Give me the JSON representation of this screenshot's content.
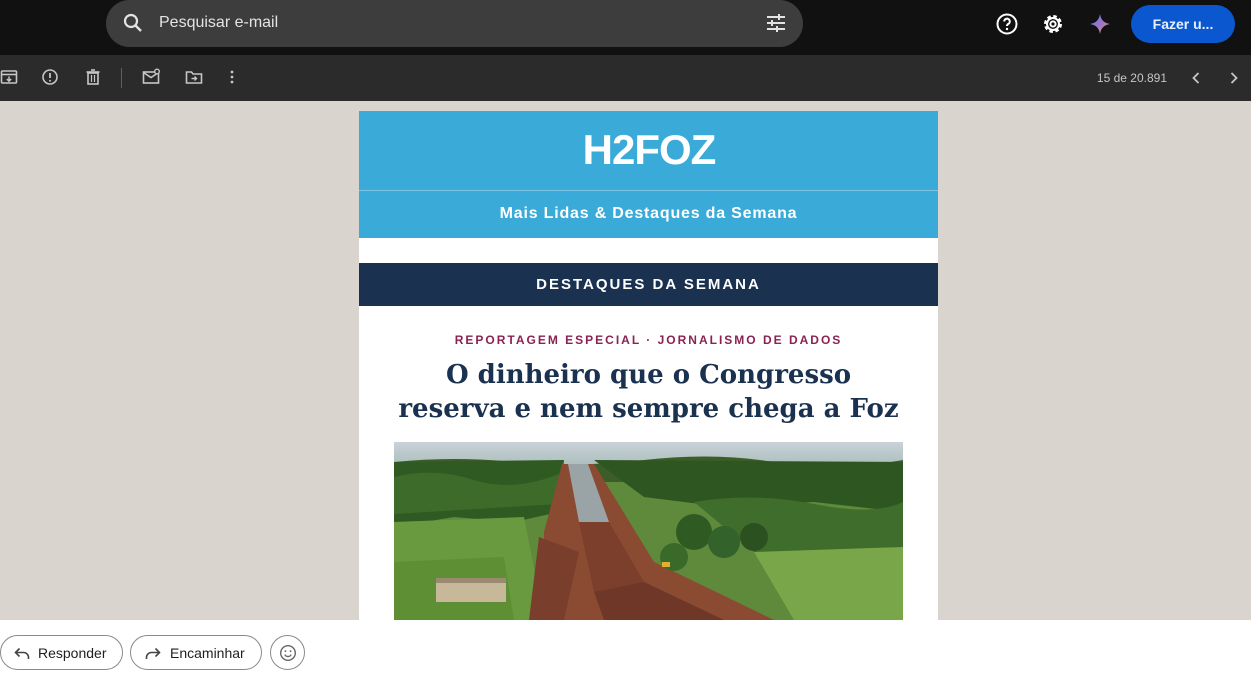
{
  "search": {
    "placeholder": "Pesquisar e-mail"
  },
  "header": {
    "cta_label": "Fazer u..."
  },
  "toolbar": {
    "counter": "15 de 20.891"
  },
  "email": {
    "logo_text": "H2FOZ",
    "subtitle": "Mais Lidas & Destaques da Semana",
    "banner": "DESTAQUES DA SEMANA",
    "kicker": "REPORTAGEM ESPECIAL · JORNALISMO DE DADOS",
    "headline_line1": "O dinheiro que o Congresso",
    "headline_line2": "reserva e nem sempre chega a Foz"
  },
  "reply_bar": {
    "reply_label": "Responder",
    "forward_label": "Encaminhar"
  },
  "colors": {
    "brand_blue": "#3aaad8",
    "navy": "#1a3150",
    "kicker": "#8a2252",
    "cta": "#0b57d0"
  },
  "icons": [
    "search-icon",
    "tune-icon",
    "help-icon",
    "settings-icon",
    "gemini-icon",
    "archive-icon",
    "report-spam-icon",
    "delete-icon",
    "mark-unread-icon",
    "move-to-icon",
    "more-icon",
    "chevron-left-icon",
    "chevron-right-icon",
    "reply-icon",
    "forward-icon",
    "emoji-icon"
  ]
}
